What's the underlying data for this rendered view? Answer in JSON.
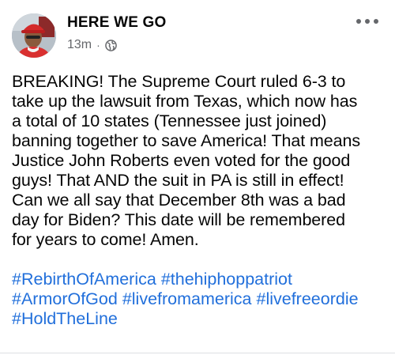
{
  "post": {
    "author": "HERE WE GO",
    "timestamp": "13m",
    "separator": "·",
    "privacy_icon": "globe-icon",
    "more_icon": "more-options-icon",
    "body": "BREAKING! The Supreme Court ruled 6-3 to\ntake up the lawsuit from Texas, which now has\na total of 10 states (Tennessee just joined)\nbanning together to save America! That means\nJustice John Roberts even voted for the good\nguys! That AND the suit in PA is still in effect!\nCan we all say that December 8th was a bad\nday for Biden? This date will be remembered\nfor years to come! Amen.",
    "hashtags": [
      "#RebirthOfAmerica",
      "#thehiphoppatriot",
      "#ArmorOfGod",
      "#livefromamerica",
      "#livefreeordie",
      "#HoldTheLine"
    ]
  },
  "colors": {
    "text": "#050505",
    "secondary": "#65676b",
    "link": "#216fdb"
  }
}
